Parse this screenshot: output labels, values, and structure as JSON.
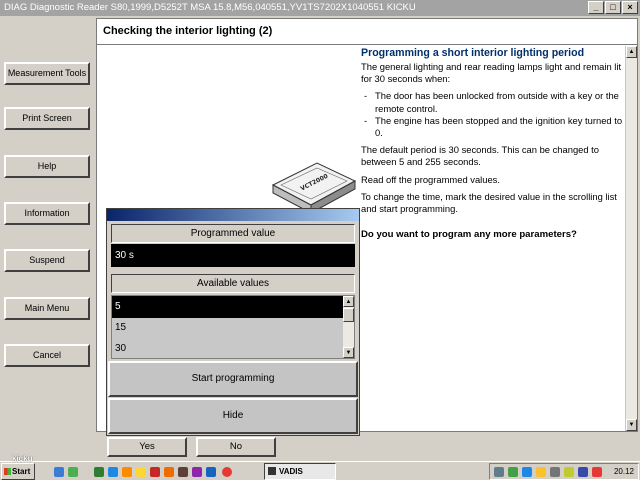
{
  "window": {
    "title": "DIAG Diagnostic Reader S80,1999,D5252T MSA 15.8,M56,040551,YV1TS7202X1040551 KICKU",
    "minimize": "_",
    "maximize": "□",
    "close": "×"
  },
  "sidebar": {
    "items": [
      {
        "label": "Measurement Tools"
      },
      {
        "label": "Print Screen"
      },
      {
        "label": "Help"
      },
      {
        "label": "Information"
      },
      {
        "label": "Suspend"
      },
      {
        "label": "Main Menu"
      },
      {
        "label": "Cancel"
      }
    ]
  },
  "header": {
    "title": "Checking the interior lighting (2)"
  },
  "content": {
    "heading": "Programming a short interior lighting period",
    "intro": "The general lighting and rear reading lamps light and remain lit for 30 seconds when:",
    "bullets": [
      "The door has been unlocked from outside with a key or the remote control.",
      "The engine has been stopped and the ignition key turned to 0."
    ],
    "default_text": "The default period is 30 seconds. This can be changed to between 5 and 255 seconds.",
    "readoff_text": "Read off the programmed values.",
    "change_text": "To change the time, mark the desired value in the scrolling list and start programming.",
    "question": "Do you want to program any more parameters?",
    "device_label": "VCT2000"
  },
  "dialog": {
    "programmed_label": "Programmed value",
    "programmed_value": "30 s",
    "available_label": "Available values",
    "available_values": [
      "5",
      "15",
      "30"
    ],
    "selected_value": "5",
    "start_button": "Start programming",
    "hide_button": "Hide"
  },
  "footer": {
    "yes": "Yes",
    "no": "No"
  },
  "taskbar": {
    "start": "Start",
    "task": "VADIS",
    "clock": "20.12"
  },
  "watermark": "kicku",
  "colors": {
    "heading": "#002f6c",
    "selection": "#000000",
    "dialog_title_start": "#0a246a"
  }
}
